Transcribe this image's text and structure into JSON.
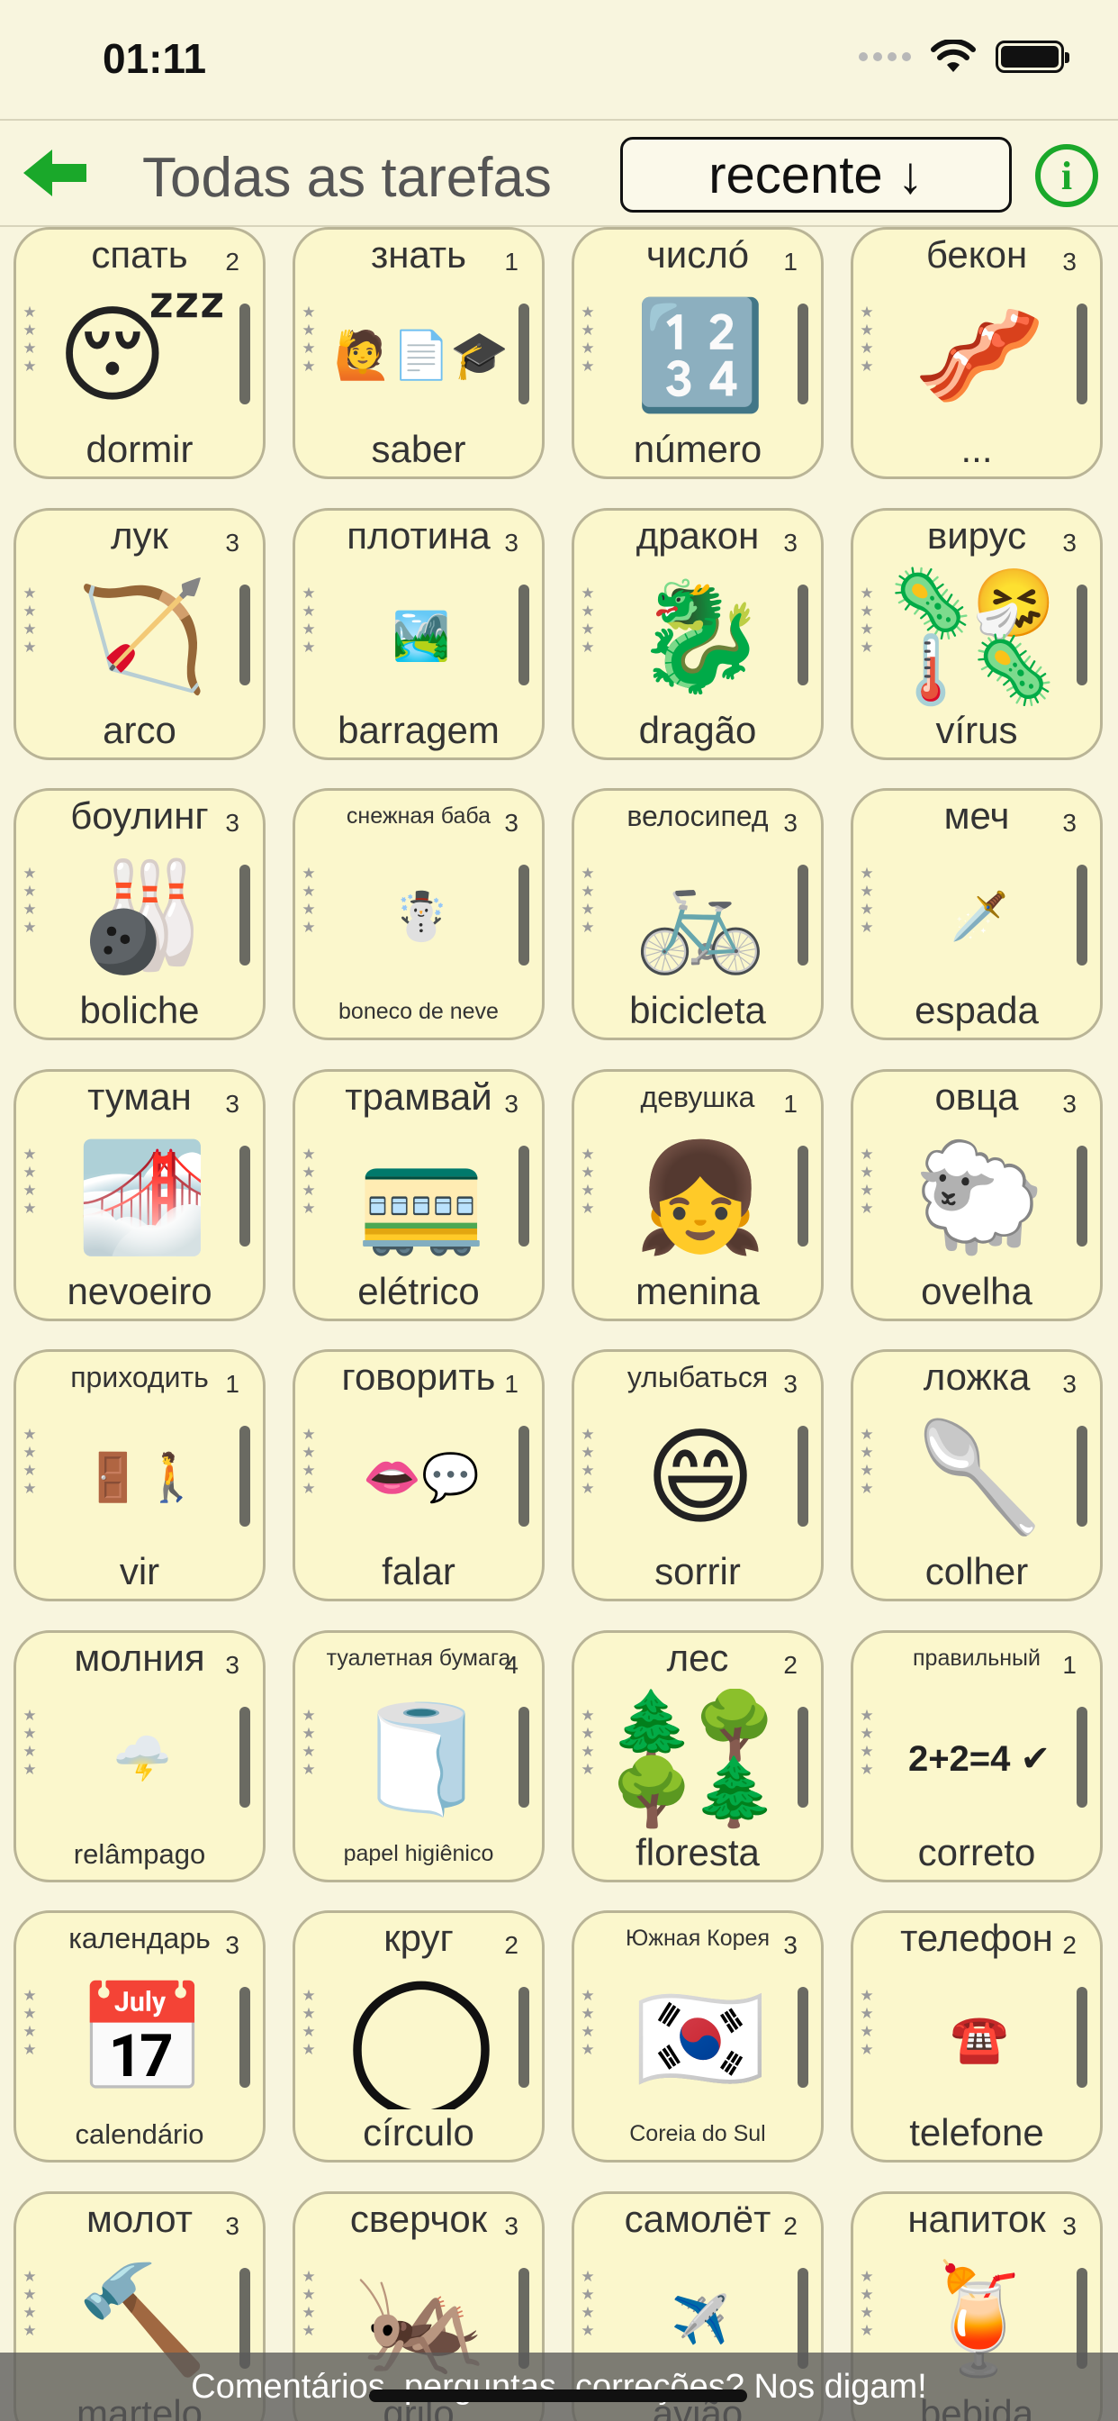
{
  "status": {
    "time": "01:11"
  },
  "header": {
    "title": "Todas as tarefas",
    "sort_label": "recente ↓",
    "back_icon": "back-arrow-icon",
    "info_icon": "info-icon",
    "accent_color": "#1aa82a"
  },
  "cards": [
    {
      "top": "спать",
      "count": "2",
      "image": "😴",
      "bottom": "dormir"
    },
    {
      "top": "знать",
      "count": "1",
      "image": "🙋📄🎓",
      "bottom": "saber"
    },
    {
      "top": "числó",
      "count": "1",
      "image": "🔢",
      "bottom": "número"
    },
    {
      "top": "бекон",
      "count": "3",
      "image": "🥓",
      "bottom": "..."
    },
    {
      "top": "лук",
      "count": "3",
      "image": "🏹",
      "bottom": "arco"
    },
    {
      "top": "плотина",
      "count": "3",
      "image": "🏞️",
      "bottom": "barragem"
    },
    {
      "top": "дракон",
      "count": "3",
      "image": "🐉",
      "bottom": "dragão"
    },
    {
      "top": "вирус",
      "count": "3",
      "image": "🦠🤧🌡️🦠",
      "bottom": "vírus"
    },
    {
      "top": "боулинг",
      "count": "3",
      "image": "🎳",
      "bottom": "boliche"
    },
    {
      "top": "снежная баба",
      "count": "3",
      "image": "☃️",
      "bottom": "boneco de neve"
    },
    {
      "top": "велосипед",
      "count": "3",
      "image": "🚲",
      "bottom": "bicicleta"
    },
    {
      "top": "меч",
      "count": "3",
      "image": "🗡️",
      "bottom": "espada"
    },
    {
      "top": "туман",
      "count": "3",
      "image": "🌁",
      "bottom": "nevoeiro"
    },
    {
      "top": "трамвай",
      "count": "3",
      "image": "🚃",
      "bottom": "elétrico"
    },
    {
      "top": "девушка",
      "count": "1",
      "image": "👧",
      "bottom": "menina"
    },
    {
      "top": "овца",
      "count": "3",
      "image": "🐑",
      "bottom": "ovelha"
    },
    {
      "top": "приходить",
      "count": "1",
      "image": "🚪🚶",
      "bottom": "vir"
    },
    {
      "top": "говорить",
      "count": "1",
      "image": "👄💬",
      "bottom": "falar"
    },
    {
      "top": "улыбаться",
      "count": "3",
      "image": "😄",
      "bottom": "sorrir"
    },
    {
      "top": "ложка",
      "count": "3",
      "image": "🥄",
      "bottom": "colher"
    },
    {
      "top": "молния",
      "count": "3",
      "image": "🌩️",
      "bottom": "relâmpago"
    },
    {
      "top": "туалетная бумага",
      "count": "4",
      "image": "🧻",
      "bottom": "papel higiênico"
    },
    {
      "top": "лес",
      "count": "2",
      "image": "🌲🌳🌳🌲",
      "bottom": "floresta"
    },
    {
      "top": "правильный",
      "count": "1",
      "image": "2+2=4 ✔",
      "bottom": "correto"
    },
    {
      "top": "календарь",
      "count": "3",
      "image": "📅",
      "bottom": "calendário"
    },
    {
      "top": "круг",
      "count": "2",
      "image": "◯",
      "bottom": "círculo"
    },
    {
      "top": "Южная Корея",
      "count": "3",
      "image": "🇰🇷",
      "bottom": "Coreia do Sul"
    },
    {
      "top": "телефон",
      "count": "2",
      "image": "☎️",
      "bottom": "telefone"
    },
    {
      "top": "молот",
      "count": "3",
      "image": "🔨",
      "bottom": "martelo"
    },
    {
      "top": "сверчок",
      "count": "3",
      "image": "🦗",
      "bottom": "grilo"
    },
    {
      "top": "самолёт",
      "count": "2",
      "image": "✈️",
      "bottom": "avião"
    },
    {
      "top": "напиток",
      "count": "3",
      "image": "🍹",
      "bottom": "bebida"
    }
  ],
  "footer": {
    "feedback": "Comentários, perguntas, correções? Nos digam!"
  }
}
